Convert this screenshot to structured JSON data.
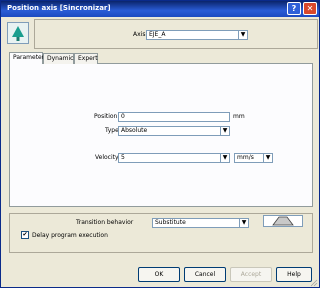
{
  "window": {
    "title": "Position axis [Sincronizar]"
  },
  "titlebar": {
    "help_label": "?",
    "close_label": "✕"
  },
  "header": {
    "axis_label": "Axis",
    "axis_value": "EJE_A"
  },
  "tabs": [
    {
      "label": "Parameter"
    },
    {
      "label": "Dynamics"
    },
    {
      "label": "Expert"
    }
  ],
  "parameter": {
    "position_label": "Position",
    "position_value": "0",
    "position_unit": "mm",
    "type_label": "Type",
    "type_value": "Absolute",
    "velocity_label": "Velocity",
    "velocity_value": "5",
    "velocity_unit": "mm/s"
  },
  "transition": {
    "label": "Transition behavior",
    "value": "Substitute",
    "delay_label": "Delay program execution",
    "delay_checked": "✔"
  },
  "buttons": {
    "ok": "OK",
    "cancel": "Cancel",
    "accept": "Accept",
    "help": "Help"
  },
  "dropdown_arrow": "▼",
  "colors": {
    "title_bar": "#0a246a",
    "close": "#d9482b",
    "panel": "#ece9d8"
  }
}
